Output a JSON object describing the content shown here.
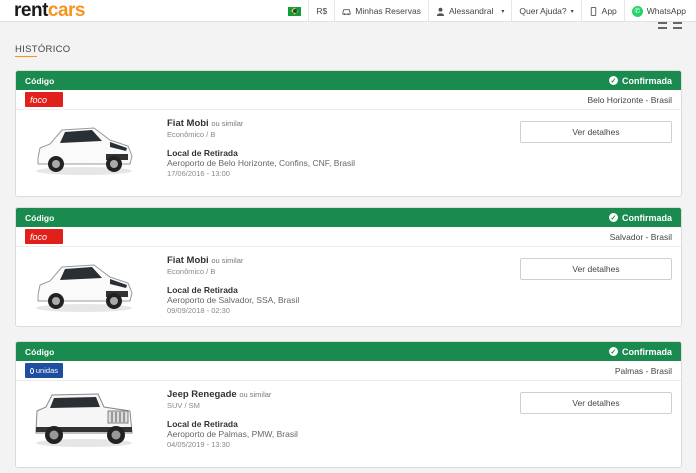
{
  "header": {
    "logo_left": "rent",
    "logo_right": "cars",
    "currency": "R$",
    "reservations": "Minhas Reservas",
    "user": "Alessandral",
    "help": "Quer Ajuda?",
    "app": "App",
    "whatsapp": "WhatsApp"
  },
  "page": {
    "title": "HISTÓRICO"
  },
  "bookings": [
    {
      "code_label": "Código",
      "status": "Confirmada",
      "supplier": "foco",
      "city": "Belo Horizonte - Brasil",
      "car_name": "Fiat Mobi",
      "similar": "ou similar",
      "car_class": "Econômico / B",
      "pickup_label": "Local de Retirada",
      "pickup_location": "Aeroporto de Belo Horizonte, Confins, CNF, Brasil",
      "pickup_date": "17/06/2016 - 13:00",
      "details_button": "Ver detalhes"
    },
    {
      "code_label": "Código",
      "status": "Confirmada",
      "supplier": "foco",
      "city": "Salvador - Brasil",
      "car_name": "Fiat Mobi",
      "similar": "ou similar",
      "car_class": "Econômico / B",
      "pickup_label": "Local de Retirada",
      "pickup_location": "Aeroporto de Salvador, SSA, Brasil",
      "pickup_date": "09/09/2018 - 02:30",
      "details_button": "Ver detalhes"
    },
    {
      "code_label": "Código",
      "status": "Confirmada",
      "supplier": "unidas",
      "city": "Palmas - Brasil",
      "car_name": "Jeep Renegade",
      "similar": "ou similar",
      "car_class": "SUV / SM",
      "pickup_label": "Local de Retirada",
      "pickup_location": "Aeroporto de Palmas, PMW, Brasil",
      "pickup_date": "04/05/2019 - 13:30",
      "details_button": "Ver detalhes"
    }
  ],
  "colors": {
    "brand_green": "#1a8a4f",
    "brand_orange": "#f7941d",
    "foco_red": "#e1201b",
    "unidas_blue": "#1d4ea0"
  }
}
